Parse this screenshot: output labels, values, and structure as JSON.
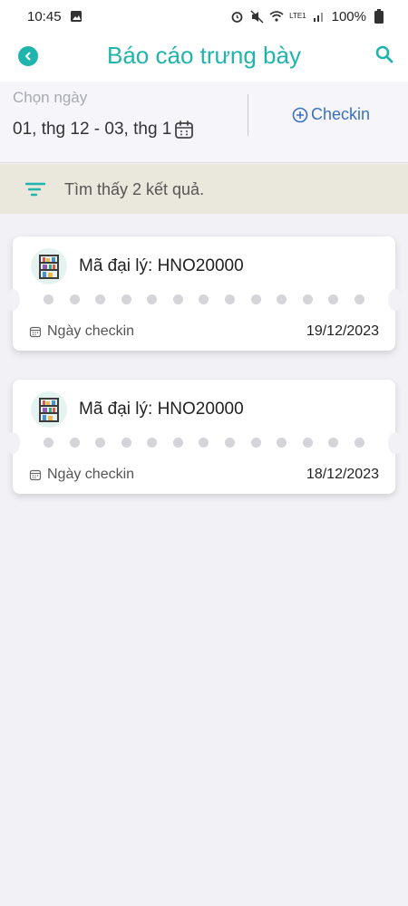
{
  "status_bar": {
    "time": "10:45",
    "battery": "100%",
    "network": "LTE1"
  },
  "header": {
    "title": "Báo cáo trưng bày",
    "back_icon": "chevron-left-icon",
    "search_icon": "search-icon"
  },
  "filter": {
    "date_label": "Chọn ngày",
    "date_range": "01, thg 12 - 03, thg 1",
    "checkin_label": "Checkin"
  },
  "results": {
    "summary": "Tìm thấy 2 kết quả."
  },
  "cards": [
    {
      "title": "Mã đại lý: HNO20000",
      "date_label": "Ngày checkin",
      "date_value": "19/12/2023"
    },
    {
      "title": "Mã đại lý: HNO20000",
      "date_label": "Ngày checkin",
      "date_value": "18/12/2023"
    }
  ],
  "colors": {
    "accent": "#1fb5ac",
    "link": "#3a6fbf",
    "result_bar": "#eae7dc"
  }
}
